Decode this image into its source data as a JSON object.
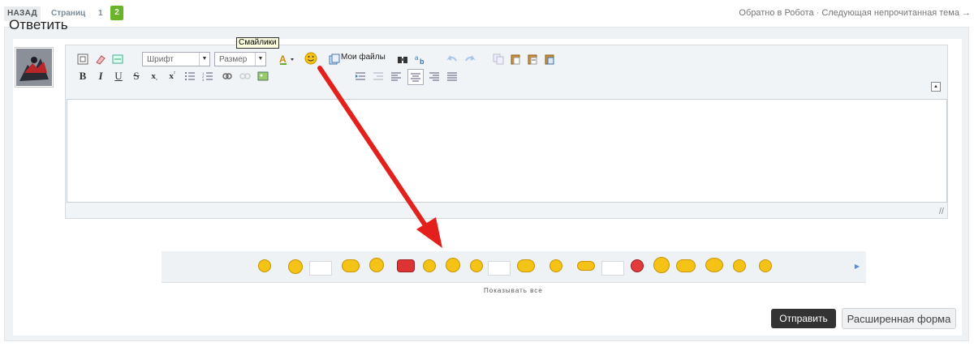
{
  "topbar": {
    "back_label": "НАЗАД",
    "pages_label": "Страниц",
    "page_1": "1",
    "page_2": "2",
    "nav_back": "Обратно в Робота",
    "nav_sep": "·",
    "nav_next": "Следующая непрочитанная тема →"
  },
  "reply": {
    "title": "Ответить"
  },
  "editor": {
    "font_select": "Шрифт",
    "size_select": "Размер",
    "my_files_label": "Мои файлы",
    "tooltip": "Смайлики",
    "text_value": ""
  },
  "smilies": {
    "show_all": "Показывать все"
  },
  "actions": {
    "send_label": "Отправить",
    "advanced_label": "Расширенная форма"
  },
  "colors": {
    "accent_green": "#6ab42a",
    "arrow_red": "#e3201b",
    "send_bg": "#333333"
  }
}
